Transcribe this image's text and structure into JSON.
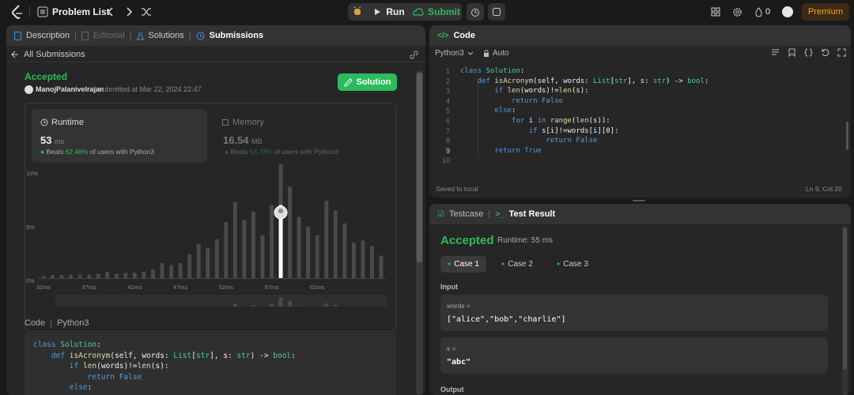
{
  "topbar": {
    "problem_list": "Problem List",
    "run": "Run",
    "submit": "Submit",
    "streak": "0",
    "premium": "Premium"
  },
  "left_tabs": [
    "Description",
    "Editorial",
    "Solutions",
    "Submissions"
  ],
  "submissions": {
    "back_label": "All Submissions",
    "status": "Accepted",
    "user": "ManojPalanivelrajan",
    "submitted_text": " submitted at Mar 22, 2024 22:47",
    "solution_btn": "Solution",
    "runtime_label": "Runtime",
    "runtime_value": "53",
    "runtime_unit": "ms",
    "runtime_beats_prefix": "Beats ",
    "runtime_beats_pct": "62.46%",
    "runtime_beats_suffix": " of users with Python3",
    "memory_label": "Memory",
    "memory_value": "16.54",
    "memory_unit": "MB",
    "memory_beats_prefix": "Beats ",
    "memory_beats_pct": "53.78%",
    "memory_beats_suffix": " of users with Python3",
    "code_label": "Code",
    "code_lang": "Python3"
  },
  "chart_data": {
    "type": "bar",
    "y_ticks": [
      "10%",
      "5%",
      "0%"
    ],
    "ylim": [
      0,
      10
    ],
    "x_ticks": [
      "32ms",
      "37ms",
      "42ms",
      "47ms",
      "52ms",
      "57ms",
      "62ms"
    ],
    "values": [
      0.2,
      0.3,
      0.3,
      0.3,
      0.3,
      0.3,
      0.4,
      0.6,
      0.4,
      0.5,
      0.5,
      0.6,
      0.8,
      1.4,
      1.2,
      1.4,
      2.2,
      3.2,
      2.8,
      3.6,
      5.2,
      7.1,
      5.4,
      6.2,
      4.0,
      6.8,
      10.6,
      8.5,
      5.7,
      4.8,
      4.0,
      7.2,
      6.3,
      5.1,
      3.3,
      3.5,
      3.0,
      2.1
    ],
    "highlight_index": 26,
    "highlight_value": 6.8
  },
  "left_code": [
    "class Solution:",
    "    def isAcronym(self, words: List[str], s: str) -> bool:",
    "        if len(words)!=len(s):",
    "            return False",
    "        else:"
  ],
  "editor": {
    "title": "Code",
    "language": "Python3",
    "mode": "Auto",
    "saved": "Saved to local",
    "cursor": "Ln 9, Col 20",
    "lines": [
      "class Solution:",
      "    def isAcronym(self, words: List[str], s: str) -> bool:",
      "        if len(words)!=len(s):",
      "            return False",
      "        else:",
      "            for i in range(len(s)):",
      "                if s[i]!=words[i][0]:",
      "                    return False",
      "        return True",
      ""
    ],
    "line_numbers": [
      "1",
      "2",
      "3",
      "4",
      "5",
      "6",
      "7",
      "8",
      "9",
      "10"
    ]
  },
  "result": {
    "tab_testcase": "Testcase",
    "tab_result": "Test Result",
    "status": "Accepted",
    "runtime": "Runtime: 55 ms",
    "cases": [
      "Case 1",
      "Case 2",
      "Case 3"
    ],
    "input_label": "Input",
    "var1_name": "words =",
    "var1_value": "[\"alice\",\"bob\",\"charlie\"]",
    "var2_name": "s =",
    "var2_value": "\"abc\"",
    "output_label": "Output"
  },
  "colors": {
    "accent_green": "#2cbb5d",
    "bar_highlight": "#ffffff",
    "bg": "#1a1a1a"
  }
}
